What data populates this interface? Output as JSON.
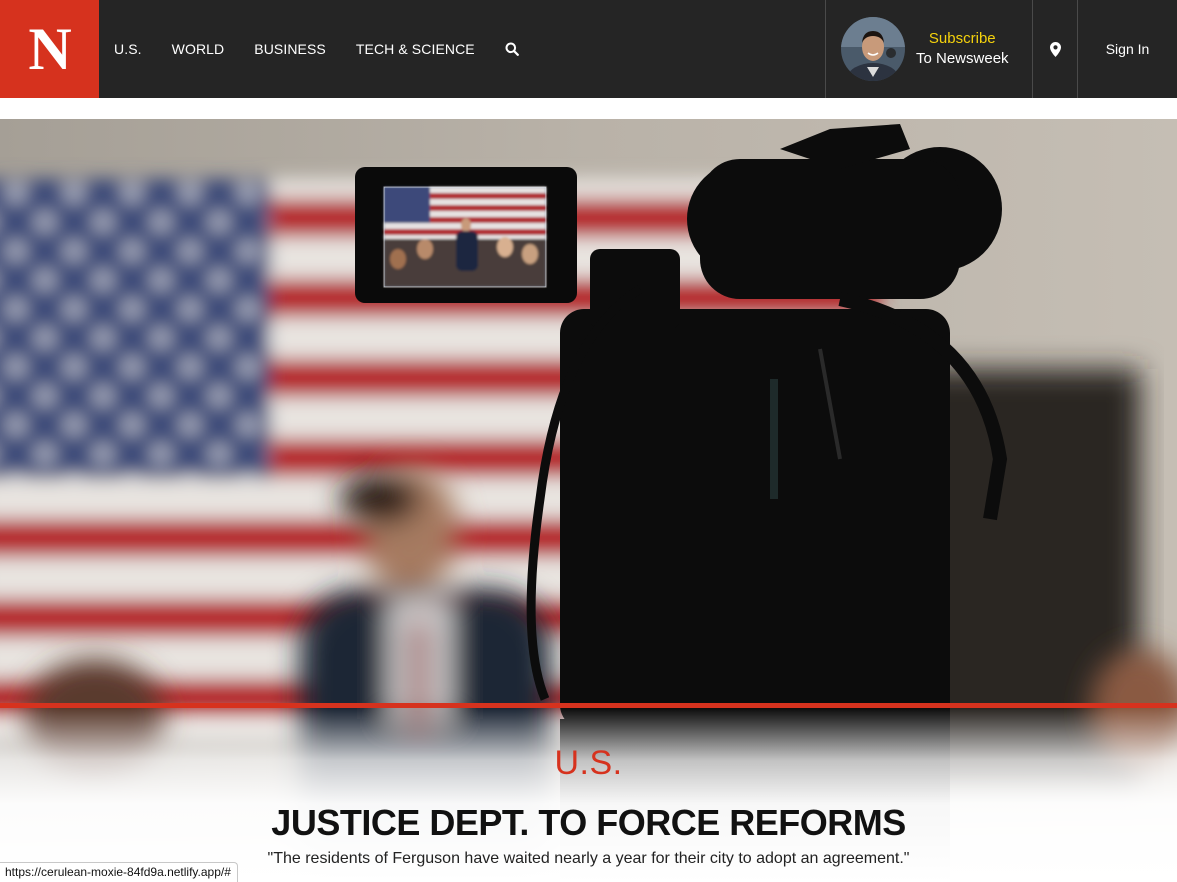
{
  "header": {
    "logo": "N",
    "nav": [
      "U.S.",
      "WORLD",
      "BUSINESS",
      "TECH & SCIENCE"
    ],
    "search_icon": "search-icon",
    "subscribe": {
      "line1": "Subscribe",
      "line2": "To Newsweek"
    },
    "location_icon": "map-pin-icon",
    "sign_in": "Sign In"
  },
  "article": {
    "category": "U.S.",
    "headline": "JUSTICE DEPT. TO FORCE REFORMS",
    "dek": "\"The residents of Ferguson have waited nearly a year for their city to adopt an agreement.\""
  },
  "status_bar": {
    "url": "https://cerulean-moxie-84fd9a.netlify.app/#"
  },
  "colors": {
    "brand_red": "#d6321e",
    "header_bg": "#252525",
    "subscribe_yellow": "#f5d20c"
  }
}
